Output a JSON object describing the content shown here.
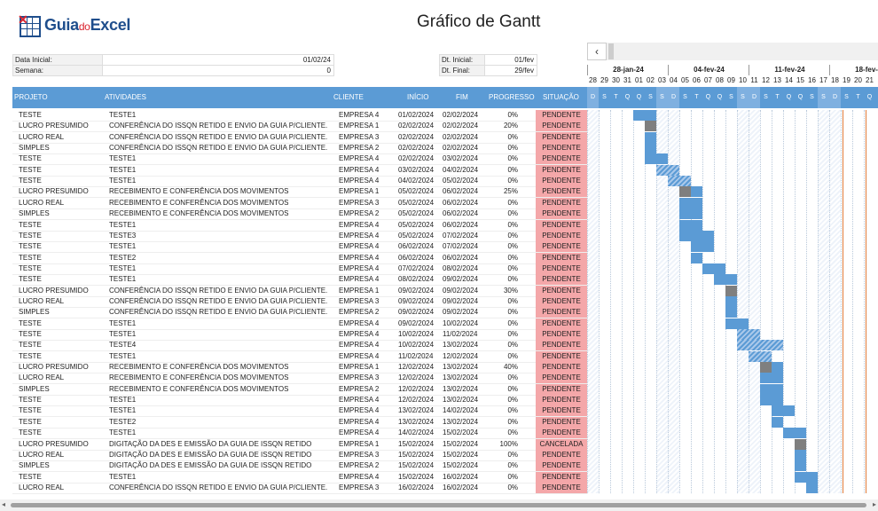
{
  "logo": {
    "part1": "Guia",
    "part2": "do",
    "part3": "Excel"
  },
  "title": "Gráfico de Gantt",
  "info_left": [
    {
      "label": "Data Inicial:",
      "value": "01/02/24"
    },
    {
      "label": "Semana:",
      "value": "0"
    }
  ],
  "info_right": [
    {
      "label": "Dt. Inicial:",
      "value": "01/fev"
    },
    {
      "label": "Dt. Final:",
      "value": "29/fev"
    }
  ],
  "scroll_left_icon": "‹",
  "weeks": [
    "28-jan-24",
    "04-fev-24",
    "11-fev-24",
    "18-fev-24"
  ],
  "day_numbers": [
    "28",
    "29",
    "30",
    "31",
    "01",
    "02",
    "03",
    "04",
    "05",
    "06",
    "07",
    "08",
    "09",
    "10",
    "11",
    "12",
    "13",
    "14",
    "15",
    "16",
    "17",
    "18",
    "19",
    "20",
    "21"
  ],
  "day_letters": [
    "D",
    "S",
    "T",
    "Q",
    "Q",
    "S",
    "S",
    "D",
    "S",
    "T",
    "Q",
    "Q",
    "S",
    "S",
    "D",
    "S",
    "T",
    "Q",
    "Q",
    "S",
    "S",
    "D",
    "S",
    "T",
    "Q"
  ],
  "headers": {
    "projeto": "PROJETO",
    "atividades": "ATIVIDADES",
    "cliente": "CLIENTE",
    "inicio": "INÍCIO",
    "fim": "FIM",
    "progresso": "PROGRESSO",
    "situacao": "SITUAÇÃO"
  },
  "rows": [
    {
      "projeto": "TESTE",
      "atividade": "TESTE1",
      "cliente": "EMPRESA 4",
      "inicio": "01/02/2024",
      "fim": "02/02/2024",
      "progresso": "0%",
      "situacao": "PENDENTE"
    },
    {
      "projeto": "LUCRO PRESUMIDO",
      "atividade": "CONFERÊNCIA DO ISSQN RETIDO E ENVIO DA GUIA P/CLIENTE.",
      "cliente": "EMPRESA 1",
      "inicio": "02/02/2024",
      "fim": "02/02/2024",
      "progresso": "20%",
      "situacao": "PENDENTE"
    },
    {
      "projeto": "LUCRO REAL",
      "atividade": "CONFERÊNCIA DO ISSQN RETIDO E ENVIO DA GUIA P/CLIENTE.",
      "cliente": "EMPRESA 3",
      "inicio": "02/02/2024",
      "fim": "02/02/2024",
      "progresso": "0%",
      "situacao": "PENDENTE"
    },
    {
      "projeto": "SIMPLES",
      "atividade": "CONFERÊNCIA DO ISSQN RETIDO E ENVIO DA GUIA P/CLIENTE.",
      "cliente": "EMPRESA 2",
      "inicio": "02/02/2024",
      "fim": "02/02/2024",
      "progresso": "0%",
      "situacao": "PENDENTE"
    },
    {
      "projeto": "TESTE",
      "atividade": "TESTE1",
      "cliente": "EMPRESA 4",
      "inicio": "02/02/2024",
      "fim": "03/02/2024",
      "progresso": "0%",
      "situacao": "PENDENTE"
    },
    {
      "projeto": "TESTE",
      "atividade": "TESTE1",
      "cliente": "EMPRESA 4",
      "inicio": "03/02/2024",
      "fim": "04/02/2024",
      "progresso": "0%",
      "situacao": "PENDENTE"
    },
    {
      "projeto": "TESTE",
      "atividade": "TESTE1",
      "cliente": "EMPRESA 4",
      "inicio": "04/02/2024",
      "fim": "05/02/2024",
      "progresso": "0%",
      "situacao": "PENDENTE"
    },
    {
      "projeto": "LUCRO PRESUMIDO",
      "atividade": "RECEBIMENTO E CONFERÊNCIA DOS MOVIMENTOS",
      "cliente": "EMPRESA 1",
      "inicio": "05/02/2024",
      "fim": "06/02/2024",
      "progresso": "25%",
      "situacao": "PENDENTE"
    },
    {
      "projeto": "LUCRO REAL",
      "atividade": "RECEBIMENTO E CONFERÊNCIA DOS MOVIMENTOS",
      "cliente": "EMPRESA 3",
      "inicio": "05/02/2024",
      "fim": "06/02/2024",
      "progresso": "0%",
      "situacao": "PENDENTE"
    },
    {
      "projeto": "SIMPLES",
      "atividade": "RECEBIMENTO E CONFERÊNCIA DOS MOVIMENTOS",
      "cliente": "EMPRESA 2",
      "inicio": "05/02/2024",
      "fim": "06/02/2024",
      "progresso": "0%",
      "situacao": "PENDENTE"
    },
    {
      "projeto": "TESTE",
      "atividade": "TESTE1",
      "cliente": "EMPRESA 4",
      "inicio": "05/02/2024",
      "fim": "06/02/2024",
      "progresso": "0%",
      "situacao": "PENDENTE"
    },
    {
      "projeto": "TESTE",
      "atividade": "TESTE3",
      "cliente": "EMPRESA 4",
      "inicio": "05/02/2024",
      "fim": "07/02/2024",
      "progresso": "0%",
      "situacao": "PENDENTE"
    },
    {
      "projeto": "TESTE",
      "atividade": "TESTE1",
      "cliente": "EMPRESA 4",
      "inicio": "06/02/2024",
      "fim": "07/02/2024",
      "progresso": "0%",
      "situacao": "PENDENTE"
    },
    {
      "projeto": "TESTE",
      "atividade": "TESTE2",
      "cliente": "EMPRESA 4",
      "inicio": "06/02/2024",
      "fim": "06/02/2024",
      "progresso": "0%",
      "situacao": "PENDENTE"
    },
    {
      "projeto": "TESTE",
      "atividade": "TESTE1",
      "cliente": "EMPRESA 4",
      "inicio": "07/02/2024",
      "fim": "08/02/2024",
      "progresso": "0%",
      "situacao": "PENDENTE"
    },
    {
      "projeto": "TESTE",
      "atividade": "TESTE1",
      "cliente": "EMPRESA 4",
      "inicio": "08/02/2024",
      "fim": "09/02/2024",
      "progresso": "0%",
      "situacao": "PENDENTE"
    },
    {
      "projeto": "LUCRO PRESUMIDO",
      "atividade": "CONFERÊNCIA DO ISSQN RETIDO E ENVIO DA GUIA P/CLIENTE.",
      "cliente": "EMPRESA 1",
      "inicio": "09/02/2024",
      "fim": "09/02/2024",
      "progresso": "30%",
      "situacao": "PENDENTE"
    },
    {
      "projeto": "LUCRO REAL",
      "atividade": "CONFERÊNCIA DO ISSQN RETIDO E ENVIO DA GUIA P/CLIENTE.",
      "cliente": "EMPRESA 3",
      "inicio": "09/02/2024",
      "fim": "09/02/2024",
      "progresso": "0%",
      "situacao": "PENDENTE"
    },
    {
      "projeto": "SIMPLES",
      "atividade": "CONFERÊNCIA DO ISSQN RETIDO E ENVIO DA GUIA P/CLIENTE.",
      "cliente": "EMPRESA 2",
      "inicio": "09/02/2024",
      "fim": "09/02/2024",
      "progresso": "0%",
      "situacao": "PENDENTE"
    },
    {
      "projeto": "TESTE",
      "atividade": "TESTE1",
      "cliente": "EMPRESA 4",
      "inicio": "09/02/2024",
      "fim": "10/02/2024",
      "progresso": "0%",
      "situacao": "PENDENTE"
    },
    {
      "projeto": "TESTE",
      "atividade": "TESTE1",
      "cliente": "EMPRESA 4",
      "inicio": "10/02/2024",
      "fim": "11/02/2024",
      "progresso": "0%",
      "situacao": "PENDENTE"
    },
    {
      "projeto": "TESTE",
      "atividade": "TESTE4",
      "cliente": "EMPRESA 4",
      "inicio": "10/02/2024",
      "fim": "13/02/2024",
      "progresso": "0%",
      "situacao": "PENDENTE"
    },
    {
      "projeto": "TESTE",
      "atividade": "TESTE1",
      "cliente": "EMPRESA 4",
      "inicio": "11/02/2024",
      "fim": "12/02/2024",
      "progresso": "0%",
      "situacao": "PENDENTE"
    },
    {
      "projeto": "LUCRO PRESUMIDO",
      "atividade": "RECEBIMENTO E CONFERÊNCIA DOS MOVIMENTOS",
      "cliente": "EMPRESA 1",
      "inicio": "12/02/2024",
      "fim": "13/02/2024",
      "progresso": "40%",
      "situacao": "PENDENTE"
    },
    {
      "projeto": "LUCRO REAL",
      "atividade": "RECEBIMENTO E CONFERÊNCIA DOS MOVIMENTOS",
      "cliente": "EMPRESA 3",
      "inicio": "12/02/2024",
      "fim": "13/02/2024",
      "progresso": "0%",
      "situacao": "PENDENTE"
    },
    {
      "projeto": "SIMPLES",
      "atividade": "RECEBIMENTO E CONFERÊNCIA DOS MOVIMENTOS",
      "cliente": "EMPRESA 2",
      "inicio": "12/02/2024",
      "fim": "13/02/2024",
      "progresso": "0%",
      "situacao": "PENDENTE"
    },
    {
      "projeto": "TESTE",
      "atividade": "TESTE1",
      "cliente": "EMPRESA 4",
      "inicio": "12/02/2024",
      "fim": "13/02/2024",
      "progresso": "0%",
      "situacao": "PENDENTE"
    },
    {
      "projeto": "TESTE",
      "atividade": "TESTE1",
      "cliente": "EMPRESA 4",
      "inicio": "13/02/2024",
      "fim": "14/02/2024",
      "progresso": "0%",
      "situacao": "PENDENTE"
    },
    {
      "projeto": "TESTE",
      "atividade": "TESTE2",
      "cliente": "EMPRESA 4",
      "inicio": "13/02/2024",
      "fim": "13/02/2024",
      "progresso": "0%",
      "situacao": "PENDENTE"
    },
    {
      "projeto": "TESTE",
      "atividade": "TESTE1",
      "cliente": "EMPRESA 4",
      "inicio": "14/02/2024",
      "fim": "15/02/2024",
      "progresso": "0%",
      "situacao": "PENDENTE"
    },
    {
      "projeto": "LUCRO PRESUMIDO",
      "atividade": "DIGITAÇÃO DA DES E EMISSÃO DA GUIA DE ISSQN RETIDO",
      "cliente": "EMPRESA 1",
      "inicio": "15/02/2024",
      "fim": "15/02/2024",
      "progresso": "100%",
      "situacao": "CANCELADA"
    },
    {
      "projeto": "LUCRO REAL",
      "atividade": "DIGITAÇÃO DA DES E EMISSÃO DA GUIA DE ISSQN RETIDO",
      "cliente": "EMPRESA 3",
      "inicio": "15/02/2024",
      "fim": "15/02/2024",
      "progresso": "0%",
      "situacao": "PENDENTE"
    },
    {
      "projeto": "SIMPLES",
      "atividade": "DIGITAÇÃO DA DES E EMISSÃO DA GUIA DE ISSQN RETIDO",
      "cliente": "EMPRESA 2",
      "inicio": "15/02/2024",
      "fim": "15/02/2024",
      "progresso": "0%",
      "situacao": "PENDENTE"
    },
    {
      "projeto": "TESTE",
      "atividade": "TESTE1",
      "cliente": "EMPRESA 4",
      "inicio": "15/02/2024",
      "fim": "16/02/2024",
      "progresso": "0%",
      "situacao": "PENDENTE"
    },
    {
      "projeto": "LUCRO REAL",
      "atividade": "CONFERÊNCIA DO ISSQN RETIDO E ENVIO DA GUIA P/CLIENTE.",
      "cliente": "EMPRESA 3",
      "inicio": "16/02/2024",
      "fim": "16/02/2024",
      "progresso": "0%",
      "situacao": "PENDENTE"
    }
  ],
  "colors": {
    "header": "#5b9bd5",
    "bar": "#5b9bd5",
    "progress": "#7f7f7f",
    "situacao_bg": "#f4a7a9",
    "today_line": "#e07b39"
  }
}
